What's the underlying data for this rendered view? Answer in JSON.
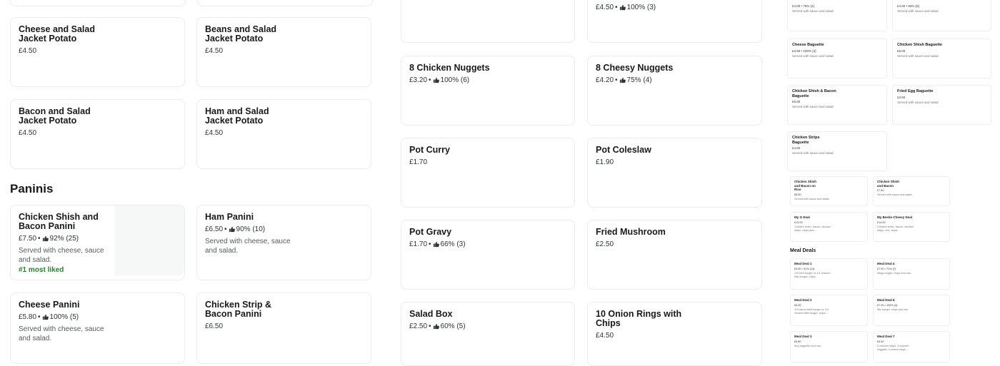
{
  "col1": {
    "items": [
      {
        "name": "Cheese and Salad Jacket Potato",
        "price": "£4.50"
      },
      {
        "name": "Beans and Salad Jacket Potato",
        "price": "£4.50"
      },
      {
        "name": "Bacon and Salad Jacket Potato",
        "price": "£4.50"
      },
      {
        "name": "Ham and Salad Jacket Potato",
        "price": "£4.50"
      }
    ],
    "paninis_title": "Paninis",
    "paninis": [
      {
        "name": "Chicken Shish and Bacon Panini",
        "price": "£7.50",
        "rating": "92% (25)",
        "desc": "Served with cheese, sauce and salad.",
        "badge": "#1 most liked"
      },
      {
        "name": "Ham Panini",
        "price": "£6.50",
        "rating": "90% (10)",
        "desc": "Served with cheese, sauce and salad."
      },
      {
        "name": "Cheese Panini",
        "price": "£5.80",
        "rating": "100% (5)",
        "desc": "Served with cheese, sauce and salad."
      },
      {
        "name": "Chicken Strip & Bacon Panini",
        "price": "£6.50"
      }
    ]
  },
  "col2": {
    "top_right": {
      "price": "£4.50",
      "rating": "100% (3)"
    },
    "items": [
      {
        "name": "8 Chicken Nuggets",
        "price": "£3.20",
        "rating": "100% (6)"
      },
      {
        "name": "8 Cheesy Nuggets",
        "price": "£4.20",
        "rating": "75% (4)"
      },
      {
        "name": "Pot Curry",
        "price": "£1.70"
      },
      {
        "name": "Pot Coleslaw",
        "price": "£1.90"
      },
      {
        "name": "Pot Gravy",
        "price": "£1.70",
        "rating": "66% (3)"
      },
      {
        "name": "Fried Mushroom",
        "price": "£2.50"
      },
      {
        "name": "Salad Box",
        "price": "£2.50",
        "rating": "60% (5)"
      },
      {
        "name": "10 Onion Rings with Chips",
        "price": "£4.50"
      }
    ]
  },
  "col3": {
    "top": [
      {
        "meta": "£4.00 • 75% (4)",
        "desc": "Served with sauce and salad."
      },
      {
        "meta": "£4.00 • 83% (6)",
        "desc": "Served with sauce and salad."
      }
    ],
    "baguettes": [
      {
        "name": "Cheese Baguette",
        "meta": "£3.50 • 100% (3)",
        "desc": "Served with sauce and salad."
      },
      {
        "name": "Chicken Shish Baguette",
        "meta": "£5.00",
        "desc": "Served with sauce and salad."
      },
      {
        "name": "Chicken Shish & Bacon Baguette",
        "meta": "£6.00",
        "desc": "Served with sauce and salad."
      },
      {
        "name": "Fried Egg Baguette",
        "meta": "£3.50",
        "desc": "Served with sauce and salad."
      },
      {
        "name": "Chicken Strips Baguette",
        "meta": "£4.50",
        "desc": "Served with sauce and salad."
      }
    ],
    "rice": [
      {
        "name": "Chicken Shish and Bacon on Rice",
        "meta": "£8.50",
        "desc": "Served with sauce and salad."
      },
      {
        "name": "Chicken Shish and Bacon",
        "meta": "£7.50",
        "desc": "Served with sauce and salad."
      },
      {
        "name": "My G Deal",
        "meta": "£13.00",
        "desc": "Chicken shish, bacon, chicken strips, chips and..."
      },
      {
        "name": "My Bestie Cheesy Deal",
        "meta": "£14.00",
        "desc": "Chicken shish, bacon, chicken strips, rice, chips..."
      }
    ],
    "meal_deals_title": "Meal Deals",
    "meal_deals": [
      {
        "name": "Meal Deal 1",
        "meta": "£5.50 • 91% (13)",
        "desc": "1/4 beef burger or 1/4 chicken fillet burger, chips..."
      },
      {
        "name": "Meal Deal 4",
        "meta": "£7.00 • 71% (7)",
        "desc": "Mega burger, chips and can."
      },
      {
        "name": "Meal Deal 2",
        "meta": "£6.50",
        "desc": "1/4 bacon beef burger or 1/4 chicken fillet burger, chips..."
      },
      {
        "name": "Meal Deal 6",
        "meta": "£7.00 • 100% (3)",
        "desc": "Mix burger, chips and can."
      },
      {
        "name": "Meal Deal 3",
        "meta": "£5.80",
        "desc": "Any baguette and can."
      },
      {
        "name": "Meal Deal 7",
        "meta": "£5.50",
        "desc": "2 chicken strips, 3 chicken nuggets, 4 onions rings..."
      }
    ]
  },
  "colors": {
    "accent_green": "#2e7d32",
    "border": "#ececec",
    "text": "#191919"
  }
}
